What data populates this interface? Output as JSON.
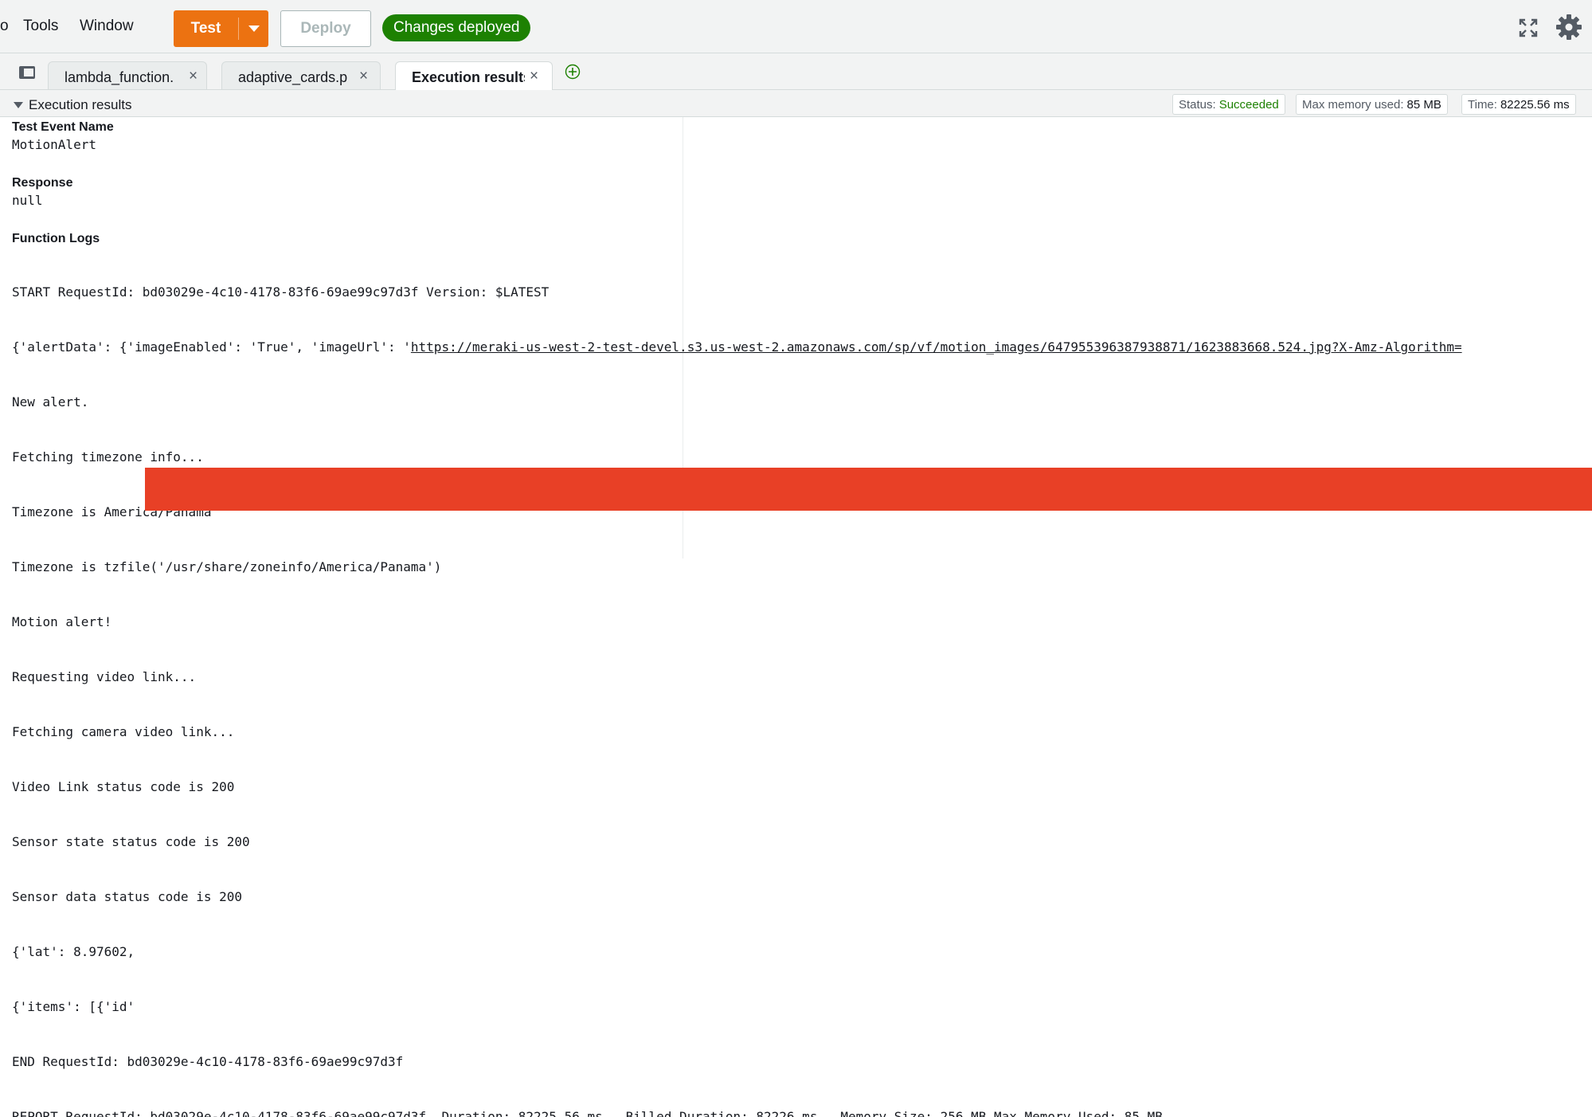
{
  "toolbar": {
    "menu": [
      "Tools",
      "Window"
    ],
    "test_label": "Test",
    "deploy_label": "Deploy",
    "deployed_badge": "Changes deployed",
    "colors": {
      "test": "#ec7211",
      "badge": "#1d8102"
    }
  },
  "tabs": [
    {
      "label": "lambda_function."
    },
    {
      "label": "adaptive_cards.p"
    },
    {
      "label": "Execution results"
    }
  ],
  "tab_close_glyph": "×",
  "panel": {
    "title": "Execution results",
    "status_label": "Status:",
    "status_value": "Succeeded",
    "memory_label": "Max memory used:",
    "memory_value": "85 MB",
    "time_label": "Time:",
    "time_value": "82225.56 ms"
  },
  "output": {
    "test_event_label": "Test Event Name",
    "test_event_value": "MotionAlert",
    "response_label": "Response",
    "response_value": "null",
    "logs_label": "Function Logs",
    "log_start": "START RequestId: bd03029e-4c10-4178-83f6-69ae99c97d3f Version: $LATEST",
    "log_alert_prefix": "{'alertData': {'imageEnabled': 'True', 'imageUrl': '",
    "log_alert_url": "https://meraki-us-west-2-test-devel.s3.us-west-2.amazonaws.com/sp/vf/motion_images/647955396387938871/1623883668.524.jpg?X-Amz-Algorithm=",
    "logs": [
      "New alert.",
      "Fetching timezone info...",
      "Timezone is America/Panama",
      "Timezone is tzfile('/usr/share/zoneinfo/America/Panama')",
      "Motion alert!",
      "Requesting video link...",
      "Fetching camera video link...",
      "Video Link status code is 200",
      "Sensor state status code is 200",
      "Sensor data status code is 200",
      "{'lat': 8.97602,",
      "{'items': [{'id'",
      "END RequestId: bd03029e-4c10-4178-83f6-69ae99c97d3f",
      "REPORT RequestId: bd03029e-4c10-4178-83f6-69ae99c97d3f  Duration: 82225.56 ms   Billed Duration: 82226 ms   Memory Size: 256 MB Max Memory Used: 85 MB"
    ],
    "redaction_color": "#e84026"
  },
  "icons": [
    "fullscreen-icon",
    "gear-icon",
    "tab-list-icon",
    "close-icon",
    "add-tab-icon",
    "caret-down-icon"
  ]
}
